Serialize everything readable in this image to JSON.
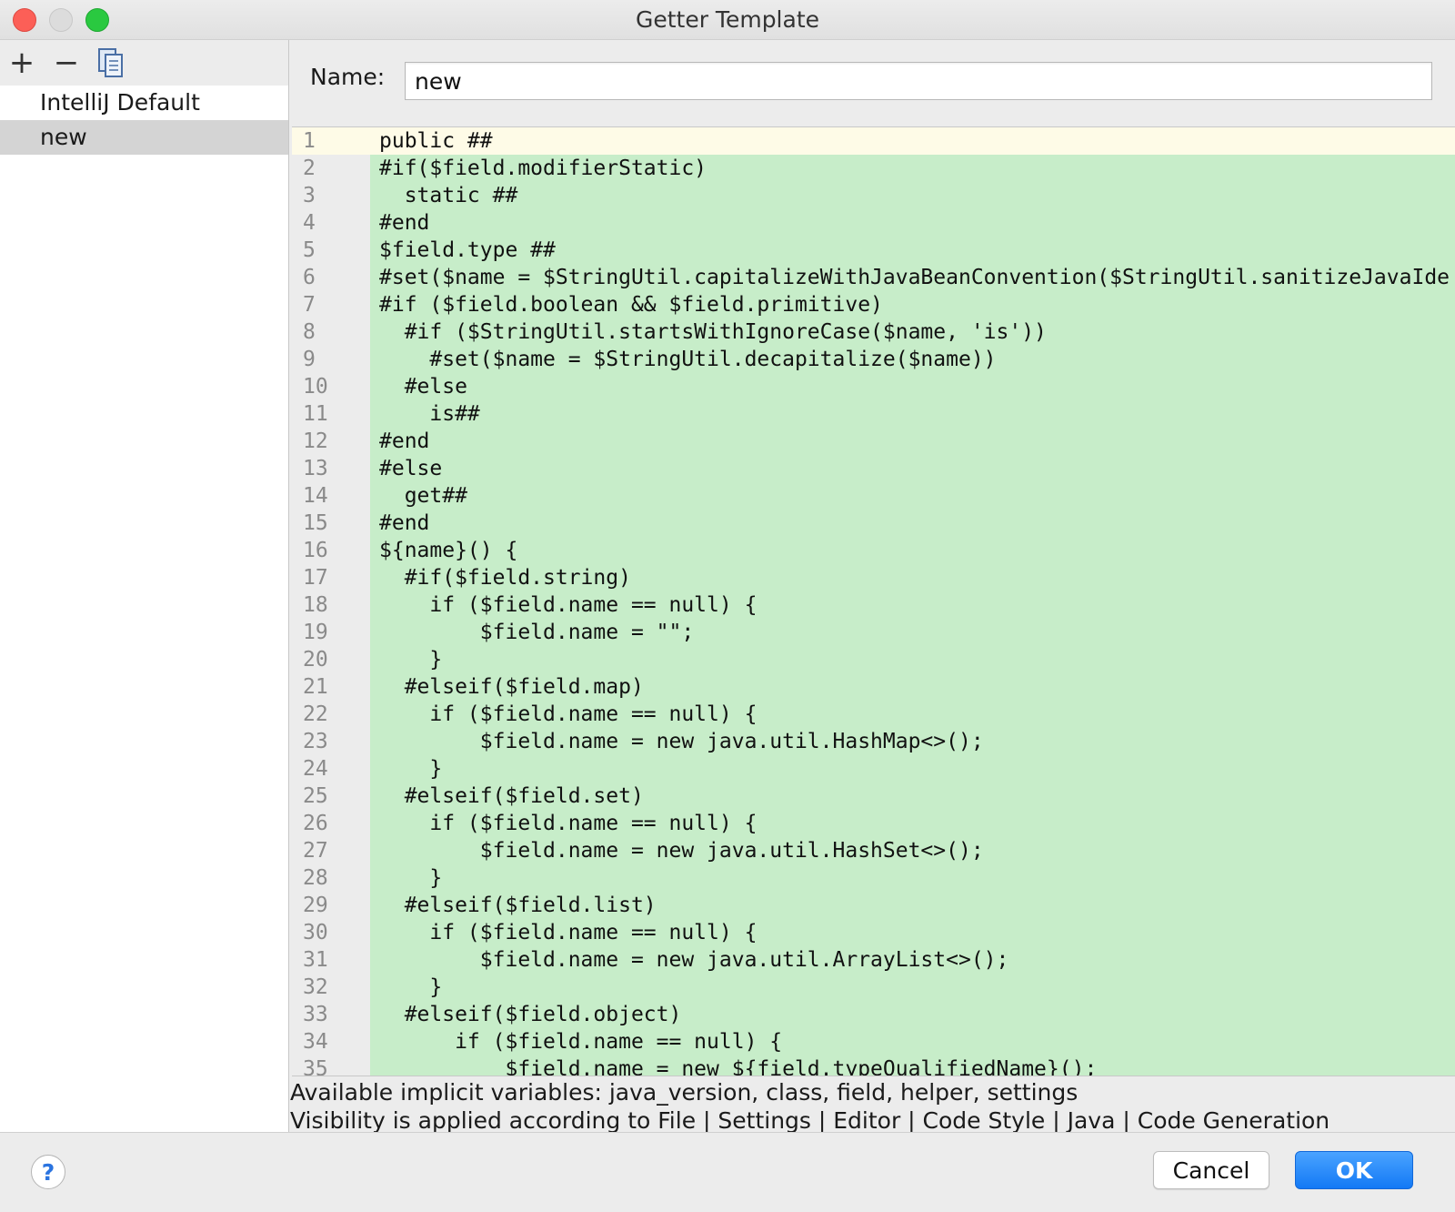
{
  "window": {
    "title": "Getter Template"
  },
  "sidebar": {
    "toolbar": {
      "add_icon": "plus-icon",
      "add_label": "+",
      "remove_icon": "minus-icon",
      "remove_label": "−",
      "copy_icon": "copy-icon"
    },
    "items": [
      {
        "label": "IntelliJ Default",
        "selected": false
      },
      {
        "label": "new",
        "selected": true
      }
    ]
  },
  "main": {
    "name_label": "Name:",
    "name_value": "new",
    "editor": {
      "current_line": 1,
      "lines": [
        "public ##",
        "#if($field.modifierStatic)",
        "  static ##",
        "#end",
        "$field.type ##",
        "#set($name = $StringUtil.capitalizeWithJavaBeanConvention($StringUtil.sanitizeJavaIde",
        "#if ($field.boolean && $field.primitive)",
        "  #if ($StringUtil.startsWithIgnoreCase($name, 'is'))",
        "    #set($name = $StringUtil.decapitalize($name))",
        "  #else",
        "    is##",
        "#end",
        "#else",
        "  get##",
        "#end",
        "${name}() {",
        "  #if($field.string)",
        "    if ($field.name == null) {",
        "        $field.name = \"\";",
        "    }",
        "  #elseif($field.map)",
        "    if ($field.name == null) {",
        "        $field.name = new java.util.HashMap<>();",
        "    }",
        "  #elseif($field.set)",
        "    if ($field.name == null) {",
        "        $field.name = new java.util.HashSet<>();",
        "    }",
        "  #elseif($field.list)",
        "    if ($field.name == null) {",
        "        $field.name = new java.util.ArrayList<>();",
        "    }",
        "  #elseif($field.object)",
        "      if ($field.name == null) {",
        "          $field.name = new ${field.typeQualifiedName}();"
      ]
    },
    "hints": [
      "Available implicit variables: java_version, class, field, helper, settings",
      "Visibility is applied according to File | Settings | Editor | Code Style | Java | Code Generation"
    ]
  },
  "footer": {
    "help_label": "?",
    "cancel_label": "Cancel",
    "ok_label": "OK"
  },
  "colors": {
    "editor_background": "#c7edc9",
    "current_line_background": "#fefbe7",
    "ok_button": "#1379f5",
    "close_button": "#fc5f57",
    "zoom_button": "#2ac940"
  }
}
